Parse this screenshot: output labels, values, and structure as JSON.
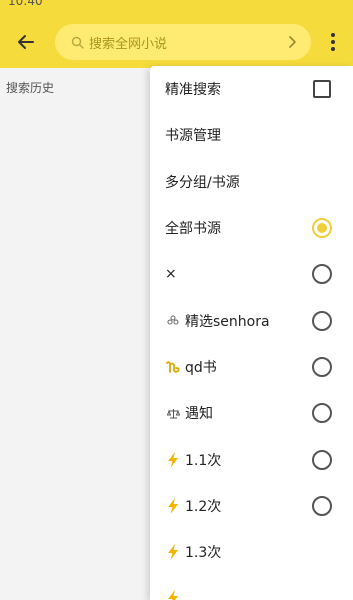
{
  "status": {
    "time": "10:40"
  },
  "header": {
    "search_placeholder": "搜索全网小说",
    "icons": {
      "back": "arrow-left-icon",
      "search": "search-icon",
      "go": "chevron-right-icon",
      "more": "more-vertical-icon"
    }
  },
  "content": {
    "history_label": "搜索历史"
  },
  "colors": {
    "accent": "#f5dc3c",
    "search_bg": "#ffeb72",
    "radio_selected": "#f0cf3a"
  },
  "menu": {
    "items": [
      {
        "label": "精准搜索",
        "control": "checkbox",
        "checked": false
      },
      {
        "label": "书源管理",
        "control": "none"
      },
      {
        "label": "多分组/书源",
        "control": "none"
      },
      {
        "label": "全部书源",
        "control": "radio",
        "selected": true
      },
      {
        "label": "×",
        "control": "radio",
        "selected": false
      },
      {
        "label": "精选senhora",
        "icon": "flower-icon",
        "control": "radio",
        "selected": false
      },
      {
        "label": "qd书",
        "icon": "capricorn-icon",
        "control": "radio",
        "selected": false
      },
      {
        "label": "遇知",
        "icon": "scales-icon",
        "control": "radio",
        "selected": false
      },
      {
        "label": "1.1次",
        "icon": "lightning-icon",
        "control": "radio",
        "selected": false
      },
      {
        "label": "1.2次",
        "icon": "lightning-icon",
        "control": "radio",
        "selected": false
      },
      {
        "label": "1.3次",
        "icon": "lightning-icon",
        "control": "none"
      }
    ]
  }
}
